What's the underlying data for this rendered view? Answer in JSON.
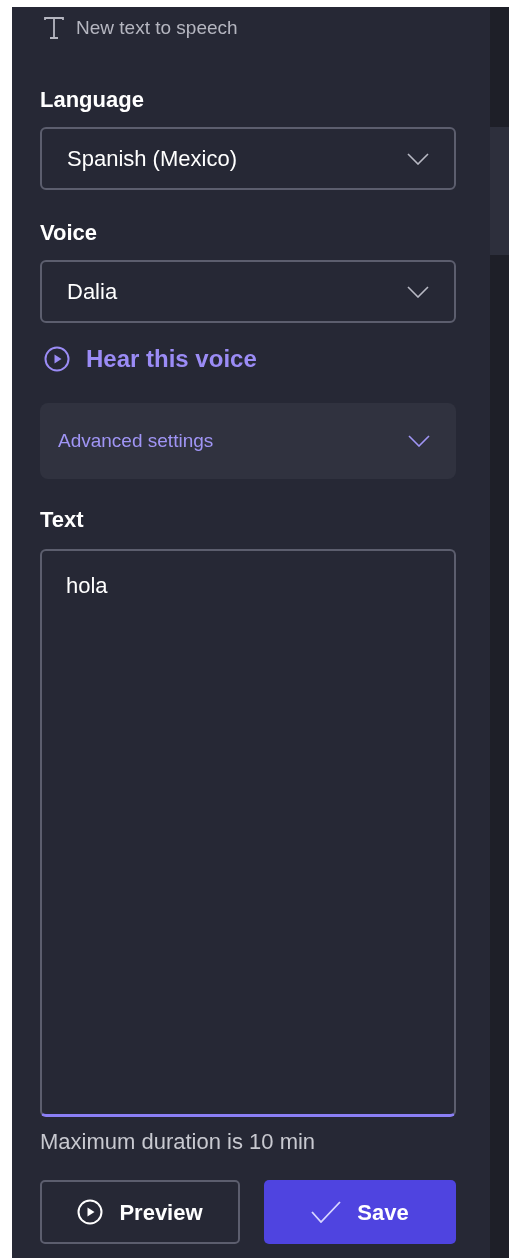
{
  "header": {
    "title": "New text to speech"
  },
  "language": {
    "label": "Language",
    "value": "Spanish (Mexico)"
  },
  "voice": {
    "label": "Voice",
    "value": "Dalia"
  },
  "hear_link": "Hear this voice",
  "advanced": {
    "label": "Advanced settings",
    "expanded": false
  },
  "text": {
    "label": "Text",
    "value": "hola",
    "caption": "Maximum duration is 10 min"
  },
  "buttons": [
    {
      "kind": "secondary",
      "label": "Preview"
    },
    {
      "kind": "primary",
      "label": "Save"
    }
  ]
}
